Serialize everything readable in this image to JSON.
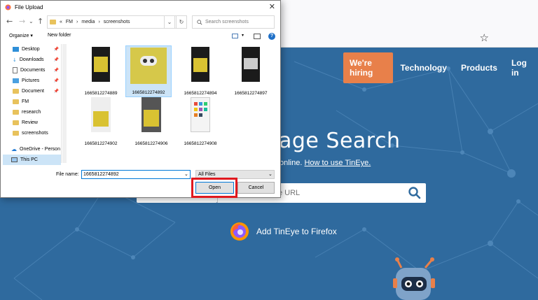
{
  "browser": {
    "star_icon": "star-icon"
  },
  "site": {
    "nav": {
      "hiring": "We're hiring",
      "links": [
        "Technology",
        "Products",
        "Log in"
      ]
    },
    "headline": "age Search",
    "subline_prefix": "online.",
    "subline_link": "How to use TinEye.",
    "url_placeholder": "e URL",
    "firefox_cta": "Add TinEye to Firefox",
    "colors": {
      "background": "#2f6a9e",
      "accent": "#e8804a"
    }
  },
  "dialog": {
    "title": "File Upload",
    "path": [
      "«",
      "FM",
      "›",
      "media",
      "›",
      "screenshots"
    ],
    "search_placeholder": "Search screenshots",
    "organize": "Organize ▾",
    "new_folder": "New folder",
    "sidebar": [
      {
        "label": "Desktop",
        "pinned": true,
        "icon": "desktop-icon"
      },
      {
        "label": "Downloads",
        "pinned": true,
        "icon": "download-icon"
      },
      {
        "label": "Documents",
        "pinned": true,
        "icon": "documents-icon"
      },
      {
        "label": "Pictures",
        "pinned": true,
        "icon": "pictures-icon"
      },
      {
        "label": "Document",
        "pinned": true,
        "icon": "folder-icon"
      },
      {
        "label": "FM",
        "pinned": false,
        "icon": "folder-icon"
      },
      {
        "label": "research",
        "pinned": false,
        "icon": "folder-icon"
      },
      {
        "label": "Review",
        "pinned": false,
        "icon": "folder-icon"
      },
      {
        "label": "screenshots",
        "pinned": false,
        "icon": "folder-icon"
      },
      {
        "label": "OneDrive - Person",
        "pinned": false,
        "icon": "cloud-icon"
      },
      {
        "label": "This PC",
        "pinned": false,
        "icon": "pc-icon"
      }
    ],
    "files": [
      {
        "name": "1665812274889",
        "selected": false
      },
      {
        "name": "1665812274892",
        "selected": true
      },
      {
        "name": "1665812274894",
        "selected": false
      },
      {
        "name": "1665812274897",
        "selected": false
      },
      {
        "name": "1665812274902",
        "selected": false
      },
      {
        "name": "1665812274906",
        "selected": false
      },
      {
        "name": "1665812274908",
        "selected": false
      }
    ],
    "file_name_label": "File name:",
    "file_name_value": "1665812274892",
    "filter": "All Files",
    "open_label": "Open",
    "cancel_label": "Cancel"
  }
}
